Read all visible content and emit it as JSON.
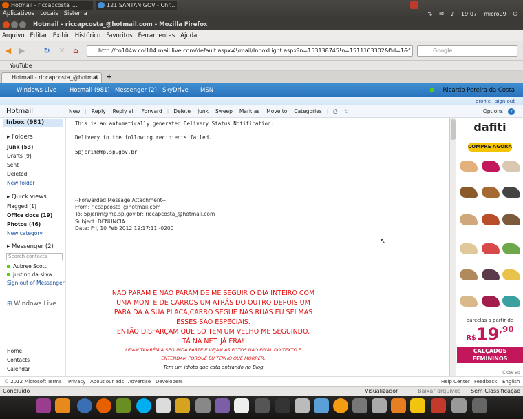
{
  "panel": {
    "tabs": [
      {
        "label": "Hotmail - riccapcosta_..."
      },
      {
        "label": "121 SANTAN GOV - Chr..."
      }
    ],
    "menu": [
      "Aplicativos",
      "Locais",
      "Sistema"
    ],
    "time": "19:07",
    "user": "micro09"
  },
  "firefox": {
    "title": "Hotmail - riccapcosta_@hotmail.com - Mozilla Firefox",
    "menu": [
      "Arquivo",
      "Editar",
      "Exibir",
      "Histórico",
      "Favoritos",
      "Ferramentas",
      "Ajuda"
    ],
    "url": "http://co104w.col104.mail.live.com/default.aspx#!/mail/InboxLight.aspx?n=153138745!n=1511163302&fid=1&f",
    "search_placeholder": "Google",
    "bookmark": "YouTube",
    "tab_label": "Hotmail - riccapcosta_@hotmai...",
    "status_left": "Concluído",
    "status_right": [
      "Visualizador",
      "Baixar arquivos",
      "Sem Classificação"
    ]
  },
  "hotmail": {
    "brand": "Windows Live",
    "nav": [
      "Hotmail (981)",
      "Messenger (2)",
      "SkyDrive",
      "MSN"
    ],
    "user_name": "Ricardo Pereira da Costa",
    "profile_links": "profile | sign out",
    "title": "Hotmail",
    "commands": [
      "New",
      "Reply",
      "Reply all",
      "Forward",
      "Delete",
      "Junk",
      "Sweep",
      "Mark as",
      "Move to",
      "Categories"
    ],
    "options": "Options",
    "inbox": "Inbox (981)",
    "folders_header": "Folders",
    "folders": [
      {
        "label": "Junk",
        "count": "(53)"
      },
      {
        "label": "Drafts",
        "count": "(9)"
      },
      {
        "label": "Sent",
        "count": ""
      },
      {
        "label": "Deleted",
        "count": ""
      }
    ],
    "new_folder": "New folder",
    "quick_header": "Quick views",
    "quick": [
      {
        "label": "Flagged",
        "count": "(1)"
      },
      {
        "label": "Office docs",
        "count": "(19)"
      },
      {
        "label": "Photos",
        "count": "(46)"
      }
    ],
    "new_category": "New category",
    "messenger_header": "Messenger (2)",
    "search_contacts": "Search contacts",
    "contacts": [
      "Aubree Scott",
      "justino da silva"
    ],
    "sign_out_messenger": "Sign out of Messenger",
    "wl_logo": "Windows Live",
    "bottom_links": [
      "Home",
      "Contacts",
      "Calendar"
    ],
    "footer": [
      "© 2012 Microsoft",
      "Terms",
      "Privacy",
      "About our ads",
      "Advertise",
      "Developers"
    ],
    "footer_right": [
      "Help Center",
      "Feedback",
      "English"
    ]
  },
  "message": {
    "line1": "This is an automatically generated Delivery Status Notification.",
    "line2": "Delivery to the following recipients failed.",
    "line3": "5pjcrim@mp.sp.gov.br",
    "fwd_header": "--Forwarded Message Attachment--",
    "from": "From: riccapcosta_@hotmail.com",
    "to": "To: 5pjcrim@mp.sp.gov.br; riccapcosta_@hotmail.com",
    "subject": "Subject: DENUNCIA",
    "date": "Date: Fri, 10 Feb 2012 19:17:11 -0200",
    "red_lines": [
      "NAO PARAM E NAO PARAM DE ME SEGUIR O DIA INTEIRO COM",
      "UMA MONTE DE CARROS UM ATRÁS DO OUTRO DEPOIS UM",
      "PARA DA A SUA PLACA,CARRO SEGUE NAS RUAS EU SEI MAS",
      "ESSES SÃO ESPECIAIS.",
      "ENTÃO DISFARÇAM QUE SO TEM UM VELHO ME SEGUINDO.",
      "TÁ NA NET.  JÁ ERA!"
    ],
    "italic_red_1": "LEIAM TAMBÉM A SEGUNDA PARTE E VEJAM AS FOTOS NAO FINAL DO TEXTO E",
    "italic_red_2": "ENTENDAM PORQUE EU TENHO QUE MORRER.",
    "italic_black": "Tem um idiota que esta entrando no Blog"
  },
  "ad": {
    "brand": "dafiti",
    "cta": "COMPRE AGORA",
    "parcelas": "parcelas a partir de",
    "currency": "R$",
    "price": "19",
    "cents": ",90",
    "category_1": "CALÇADOS",
    "category_2": "FEMININOS",
    "close": "Close ad"
  }
}
